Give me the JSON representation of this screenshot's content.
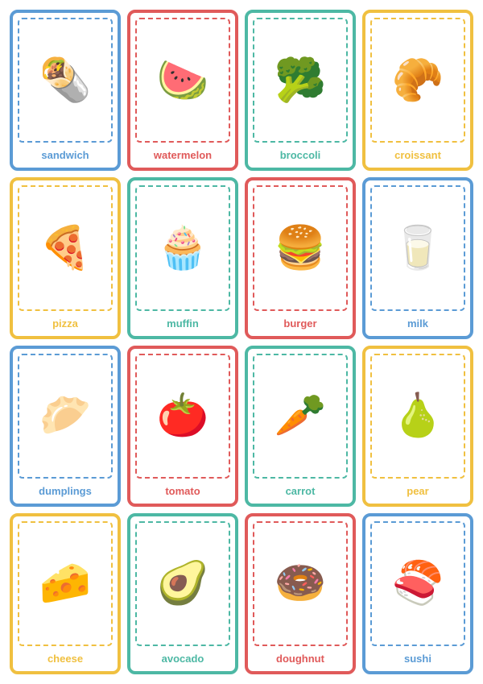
{
  "rows": [
    [
      {
        "color": "blue",
        "emoji": "🌯",
        "label": "sandwich"
      },
      {
        "color": "red",
        "emoji": "🍉",
        "label": "watermelon"
      },
      {
        "color": "teal",
        "emoji": "🥦",
        "label": "broccoli"
      },
      {
        "color": "yellow",
        "emoji": "🥐",
        "label": "croissant"
      }
    ],
    [
      {
        "color": "yellow",
        "emoji": "🍕",
        "label": "pizza"
      },
      {
        "color": "teal",
        "emoji": "🧁",
        "label": "muffin"
      },
      {
        "color": "red",
        "emoji": "🍔",
        "label": "burger"
      },
      {
        "color": "blue",
        "emoji": "🥛",
        "label": "milk"
      }
    ],
    [
      {
        "color": "blue",
        "emoji": "🥟",
        "label": "dumplings"
      },
      {
        "color": "red",
        "emoji": "🍅",
        "label": "tomato"
      },
      {
        "color": "teal",
        "emoji": "🥕",
        "label": "carrot"
      },
      {
        "color": "yellow",
        "emoji": "🍐",
        "label": "pear"
      }
    ],
    [
      {
        "color": "yellow",
        "emoji": "🧀",
        "label": "cheese"
      },
      {
        "color": "teal",
        "emoji": "🥑",
        "label": "avocado"
      },
      {
        "color": "red",
        "emoji": "🍩",
        "label": "doughnut"
      },
      {
        "color": "blue",
        "emoji": "🍣",
        "label": "sushi"
      }
    ]
  ]
}
